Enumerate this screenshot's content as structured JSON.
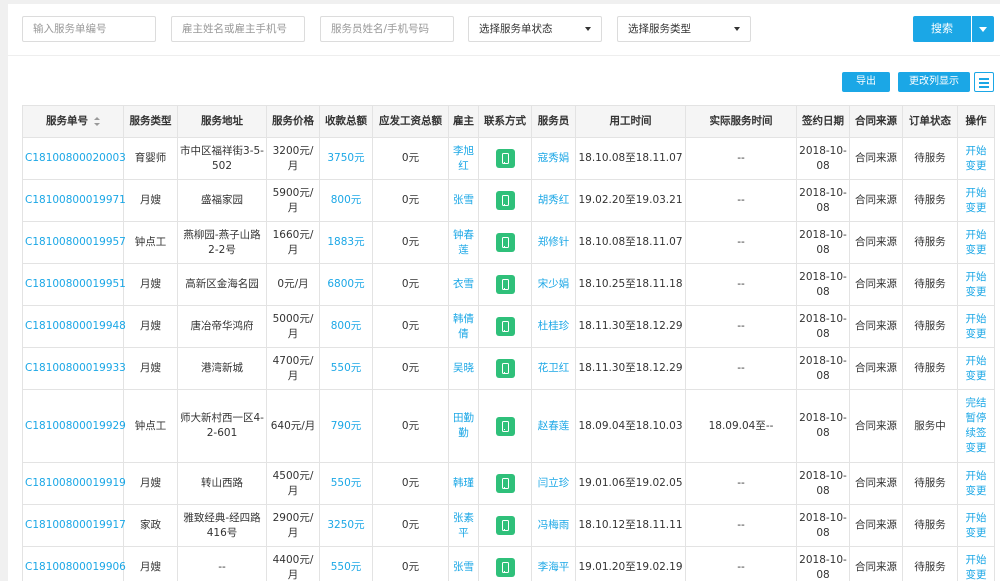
{
  "filters": {
    "order_no_placeholder": "输入服务单编号",
    "employer_placeholder": "雇主姓名或雇主手机号",
    "staff_placeholder": "服务员姓名/手机号码",
    "status_select": "选择服务单状态",
    "type_select": "选择服务类型",
    "search_label": "搜索"
  },
  "toolbar": {
    "export_label": "导出",
    "columns_label": "更改列显示"
  },
  "table": {
    "headers": [
      "服务单号",
      "服务类型",
      "服务地址",
      "服务价格",
      "收款总额",
      "应发工资总额",
      "雇主",
      "联系方式",
      "服务员",
      "用工时间",
      "实际服务时间",
      "签约日期",
      "合同来源",
      "订单状态",
      "操作"
    ],
    "rows": [
      {
        "id": "C18100800020003",
        "type": "育婴师",
        "address": "市中区福祥街3-5-502",
        "price": "3200元/月",
        "received": "3750元",
        "wage": "0元",
        "employer": "李旭红",
        "staff": "寇秀娟",
        "work_time": "18.10.08至18.11.07",
        "actual_time": "--",
        "sign_date": "2018-10-08",
        "source": "合同来源",
        "status": "待服务",
        "actions": [
          "开始",
          "变更"
        ]
      },
      {
        "id": "C18100800019971",
        "type": "月嫂",
        "address": "盛福家园",
        "price": "5900元/月",
        "received": "800元",
        "wage": "0元",
        "employer": "张雪",
        "staff": "胡秀红",
        "work_time": "19.02.20至19.03.21",
        "actual_time": "--",
        "sign_date": "2018-10-08",
        "source": "合同来源",
        "status": "待服务",
        "actions": [
          "开始",
          "变更"
        ]
      },
      {
        "id": "C18100800019957",
        "type": "钟点工",
        "address": "燕柳园-燕子山路2-2号",
        "price": "1660元/月",
        "received": "1883元",
        "wage": "0元",
        "employer": "钟春莲",
        "staff": "郑修针",
        "work_time": "18.10.08至18.11.07",
        "actual_time": "--",
        "sign_date": "2018-10-08",
        "source": "合同来源",
        "status": "待服务",
        "actions": [
          "开始",
          "变更"
        ]
      },
      {
        "id": "C18100800019951",
        "type": "月嫂",
        "address": "高新区金海名园",
        "price": "0元/月",
        "received": "6800元",
        "wage": "0元",
        "employer": "衣雪",
        "staff": "宋少娟",
        "work_time": "18.10.25至18.11.18",
        "actual_time": "--",
        "sign_date": "2018-10-08",
        "source": "合同来源",
        "status": "待服务",
        "actions": [
          "开始",
          "变更"
        ]
      },
      {
        "id": "C18100800019948",
        "type": "月嫂",
        "address": "唐冶帝华鸿府",
        "price": "5000元/月",
        "received": "800元",
        "wage": "0元",
        "employer": "韩倩倩",
        "staff": "杜桂珍",
        "work_time": "18.11.30至18.12.29",
        "actual_time": "--",
        "sign_date": "2018-10-08",
        "source": "合同来源",
        "status": "待服务",
        "actions": [
          "开始",
          "变更"
        ]
      },
      {
        "id": "C18100800019933",
        "type": "月嫂",
        "address": "港湾新城",
        "price": "4700元/月",
        "received": "550元",
        "wage": "0元",
        "employer": "吴晓",
        "staff": "花卫红",
        "work_time": "18.11.30至18.12.29",
        "actual_time": "--",
        "sign_date": "2018-10-08",
        "source": "合同来源",
        "status": "待服务",
        "actions": [
          "开始",
          "变更"
        ]
      },
      {
        "id": "C18100800019929",
        "type": "钟点工",
        "address": "师大新村西一区4-2-601",
        "price": "640元/月",
        "received": "790元",
        "wage": "0元",
        "employer": "田勤勤",
        "staff": "赵春莲",
        "work_time": "18.09.04至18.10.03",
        "actual_time": "18.09.04至--",
        "sign_date": "2018-10-08",
        "source": "合同来源",
        "status": "服务中",
        "actions": [
          "完结",
          "暂停",
          "续签",
          "变更"
        ]
      },
      {
        "id": "C18100800019919",
        "type": "月嫂",
        "address": "转山西路",
        "price": "4500元/月",
        "received": "550元",
        "wage": "0元",
        "employer": "韩瑾",
        "staff": "闫立珍",
        "work_time": "19.01.06至19.02.05",
        "actual_time": "--",
        "sign_date": "2018-10-08",
        "source": "合同来源",
        "status": "待服务",
        "actions": [
          "开始",
          "变更"
        ]
      },
      {
        "id": "C18100800019917",
        "type": "家政",
        "address": "雅致经典-经四路416号",
        "price": "2900元/月",
        "received": "3250元",
        "wage": "0元",
        "employer": "张素平",
        "staff": "冯梅雨",
        "work_time": "18.10.12至18.11.11",
        "actual_time": "--",
        "sign_date": "2018-10-08",
        "source": "合同来源",
        "status": "待服务",
        "actions": [
          "开始",
          "变更"
        ]
      },
      {
        "id": "C18100800019906",
        "type": "月嫂",
        "address": "--",
        "price": "4400元/月",
        "received": "550元",
        "wage": "0元",
        "employer": "张雪",
        "staff": "李海平",
        "work_time": "19.01.20至19.02.19",
        "actual_time": "--",
        "sign_date": "2018-10-08",
        "source": "合同来源",
        "status": "待服务",
        "actions": [
          "开始",
          "变更"
        ]
      }
    ]
  },
  "colors": {
    "accent": "#1ba7e6",
    "phone_green": "#2fc07a"
  },
  "icons": {
    "contact": "phone-icon",
    "sort": "sort-icon",
    "menu": "menu-icon"
  }
}
